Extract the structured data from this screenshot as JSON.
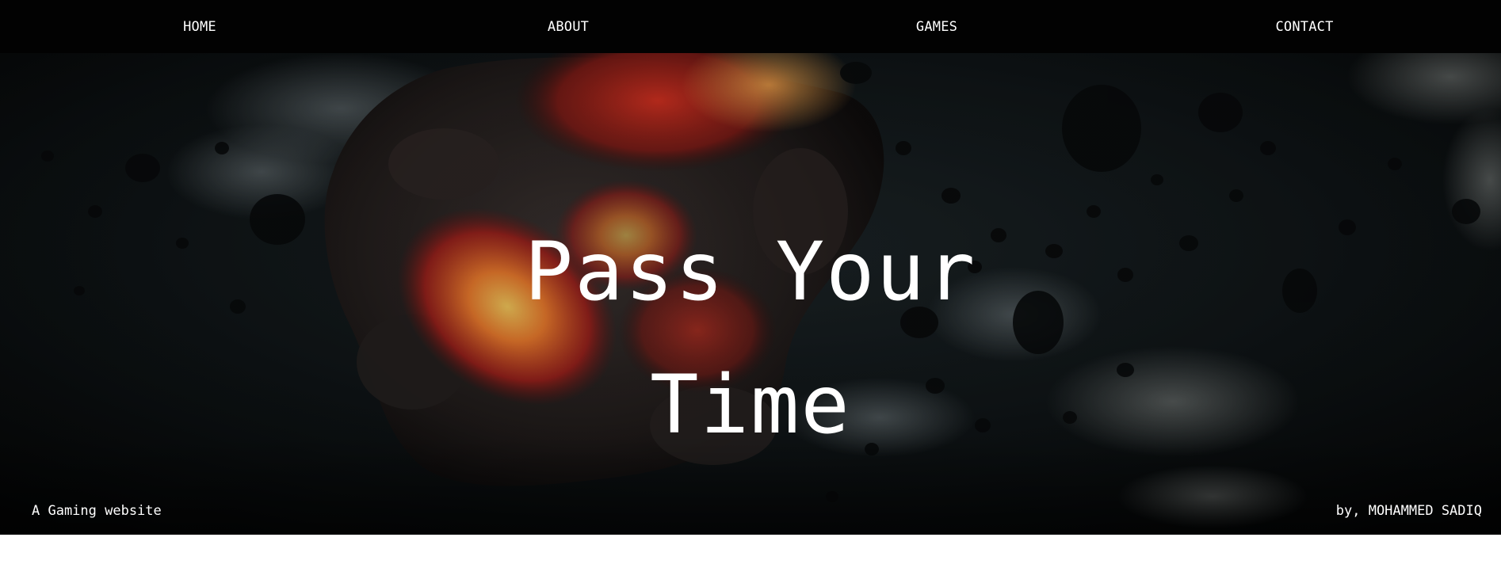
{
  "nav": {
    "items": [
      {
        "label": "HOME"
      },
      {
        "label": "ABOUT"
      },
      {
        "label": "GAMES"
      },
      {
        "label": "CONTACT"
      }
    ]
  },
  "hero": {
    "title_line1": "Pass Your",
    "title_line2": "Time",
    "tagline": "A Gaming website",
    "author": "by, MOHAMMED SADIQ",
    "background": "burning-asteroid-field-image"
  },
  "colors": {
    "nav_bg": "#020202",
    "text": "#ffffff",
    "lava_red": "#c0261a",
    "lava_orange": "#e8792c",
    "space_dark": "#0b0e10"
  }
}
